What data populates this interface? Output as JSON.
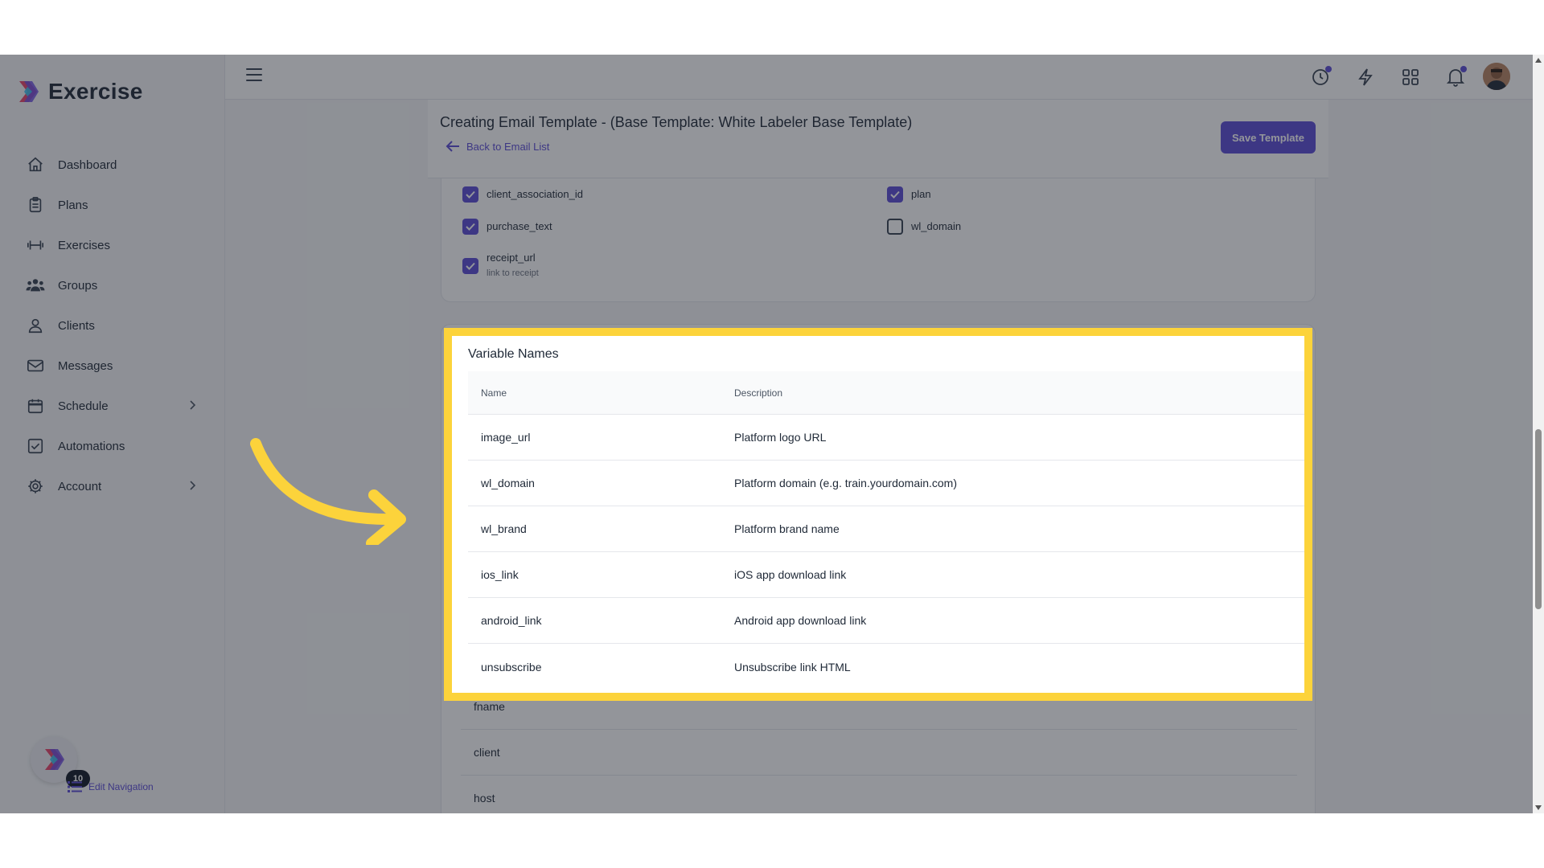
{
  "brand": {
    "name": "Exercise"
  },
  "sidebar": {
    "items": [
      {
        "label": "Dashboard",
        "icon": "home-icon"
      },
      {
        "label": "Plans",
        "icon": "clipboard-icon"
      },
      {
        "label": "Exercises",
        "icon": "dumbbell-icon"
      },
      {
        "label": "Groups",
        "icon": "users-icon"
      },
      {
        "label": "Clients",
        "icon": "user-icon"
      },
      {
        "label": "Messages",
        "icon": "mail-icon"
      },
      {
        "label": "Schedule",
        "icon": "calendar-icon",
        "has_submenu": true
      },
      {
        "label": "Automations",
        "icon": "checkbox-icon"
      },
      {
        "label": "Account",
        "icon": "gear-icon",
        "has_submenu": true
      }
    ],
    "badge_count": "10",
    "edit_navigation": "Edit Navigation"
  },
  "page": {
    "title": "Creating Email Template - (Base Template: White Labeler Base Template)",
    "back_link": "Back to Email List",
    "save_button": "Save Template"
  },
  "checkboxes": [
    {
      "label": "client_association_id",
      "checked": true
    },
    {
      "label": "plan",
      "checked": true
    },
    {
      "label": "purchase_text",
      "checked": true
    },
    {
      "label": "wl_domain",
      "checked": false
    },
    {
      "label": "receipt_url",
      "sub": "link to receipt",
      "checked": true
    }
  ],
  "variables": {
    "title": "Variable Names",
    "headers": {
      "name": "Name",
      "description": "Description"
    },
    "rows": [
      {
        "name": "image_url",
        "description": "Platform logo URL"
      },
      {
        "name": "wl_domain",
        "description": "Platform domain (e.g. train.yourdomain.com)"
      },
      {
        "name": "wl_brand",
        "description": "Platform brand name"
      },
      {
        "name": "ios_link",
        "description": "iOS app download link"
      },
      {
        "name": "android_link",
        "description": "Android app download link"
      },
      {
        "name": "unsubscribe",
        "description": "Unsubscribe link HTML"
      },
      {
        "name": "fname",
        "description": ""
      },
      {
        "name": "client",
        "description": ""
      },
      {
        "name": "host",
        "description": ""
      }
    ]
  },
  "colors": {
    "accent": "#5b4bd5",
    "highlight": "#fcd33b"
  }
}
